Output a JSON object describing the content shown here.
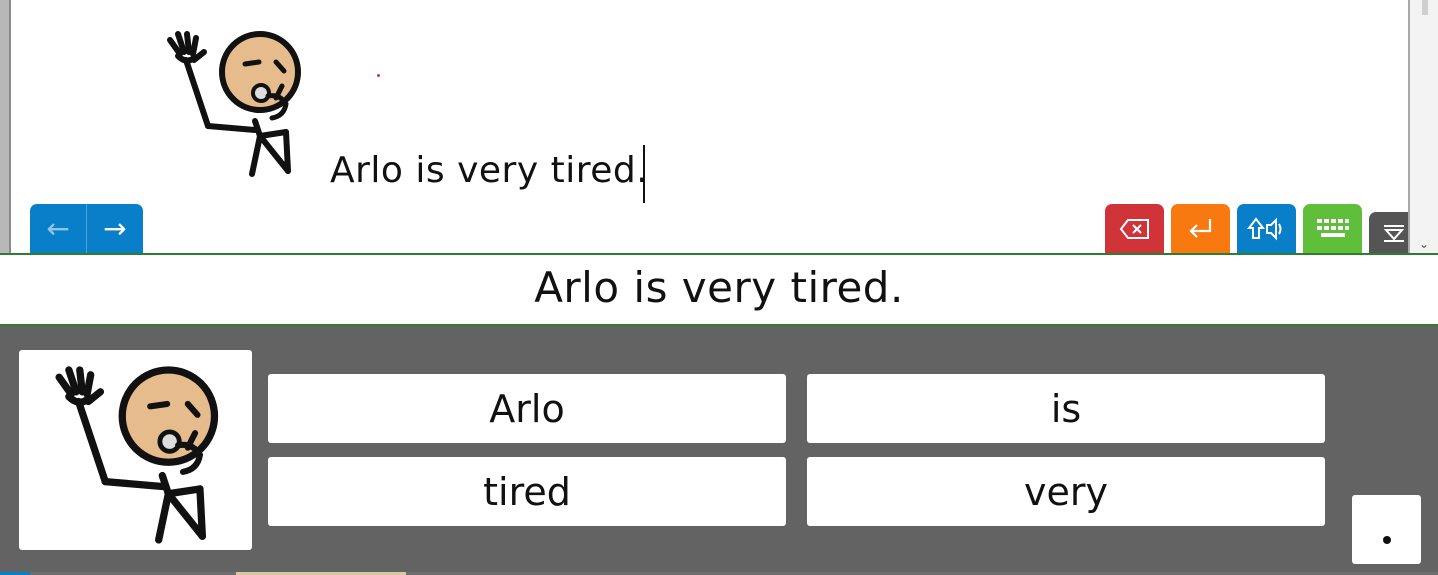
{
  "editor": {
    "text": "Arlo is very tired.",
    "symbol_icon": "arlo-tired-symbol"
  },
  "nav": {
    "back_icon": "←",
    "forward_icon": "→"
  },
  "toolbar": {
    "delete_icon": "backspace-icon",
    "enter_icon": "enter-icon",
    "speak_icon": "speak-icon",
    "keyboard_icon": "keyboard-icon",
    "collapse_icon": "collapse-icon",
    "colors": {
      "delete": "#d13438",
      "enter": "#f7790f",
      "speak": "#0a7fc9",
      "keyboard": "#5fbf3a",
      "collapse": "#555555"
    }
  },
  "sentence_bar": {
    "text": "Arlo is very tired."
  },
  "word_panel": {
    "picture_icon": "arlo-tired-symbol",
    "words": [
      "Arlo",
      "is",
      "tired",
      "very"
    ],
    "punctuation": "period"
  }
}
